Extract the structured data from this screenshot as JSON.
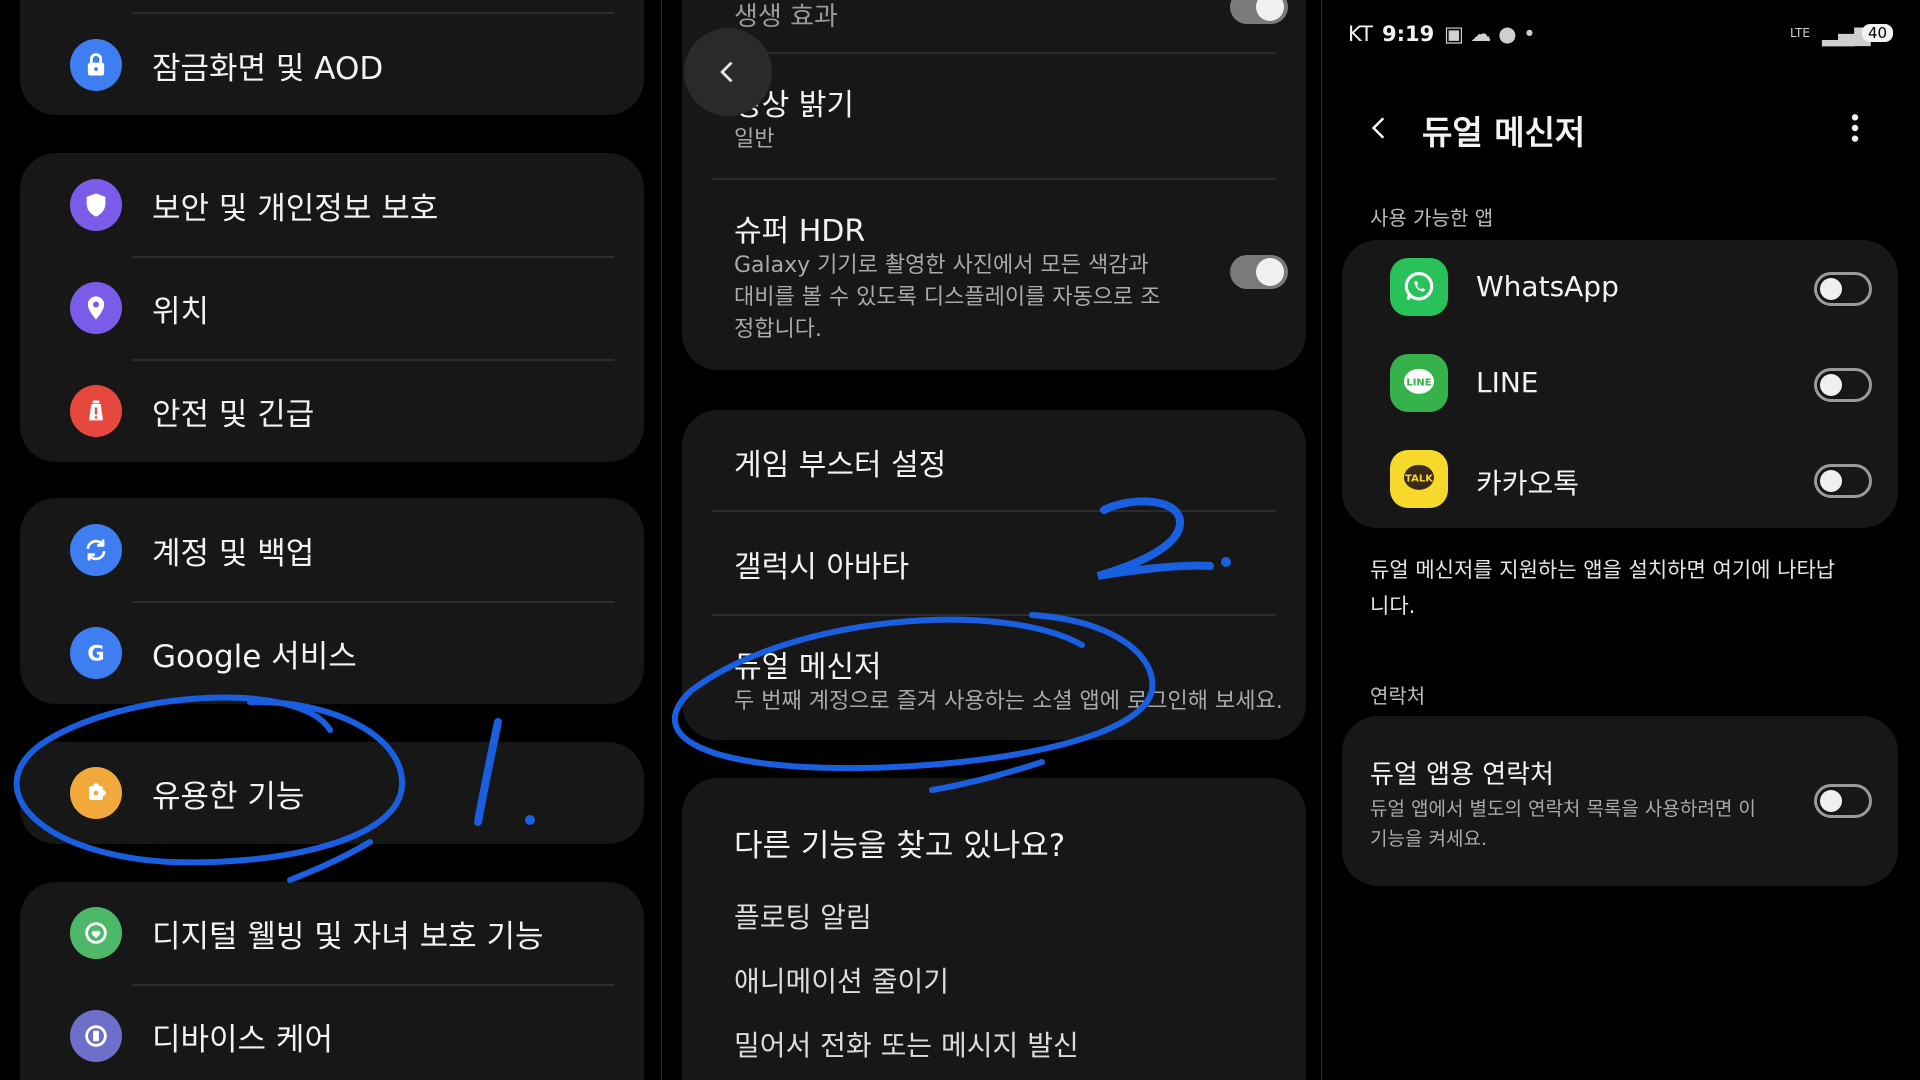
{
  "panel1": {
    "items": [
      {
        "label": "잠금화면 및 AOD",
        "icon": "lock-icon",
        "color": "#3e7ef0"
      },
      {
        "label": "보안 및 개인정보 보호",
        "icon": "shield-icon",
        "color": "#7b5ce8"
      },
      {
        "label": "위치",
        "icon": "location-icon",
        "color": "#7b5ce8"
      },
      {
        "label": "안전 및 긴급",
        "icon": "alert-icon",
        "color": "#e5483c"
      },
      {
        "label": "계정 및 백업",
        "icon": "sync-icon",
        "color": "#3e7ef0"
      },
      {
        "label": "Google 서비스",
        "icon": "google-icon",
        "color": "#3e7ef0"
      },
      {
        "label": "유용한 기능",
        "icon": "puzzle-icon",
        "color": "#f2a93b"
      },
      {
        "label": "디지털 웰빙 및 자녀 보호 기능",
        "icon": "wellbeing-icon",
        "color": "#4cb868"
      },
      {
        "label": "디바이스 케어",
        "icon": "device-care-icon",
        "color": "#6d6fc8"
      }
    ],
    "annotation": "1."
  },
  "panel2": {
    "top_partial": "생생 효과",
    "video_brightness": {
      "title": "영상 밝기",
      "value": "일반"
    },
    "super_hdr": {
      "title": "슈퍼 HDR",
      "desc": "Galaxy 기기로 촬영한 사진에서 모든 색감과 대비를 볼 수 있도록 디스플레이를 자동으로 조정합니다.",
      "on": true
    },
    "game_booster": "게임 부스터 설정",
    "galaxy_avatar": "갤럭시 아바타",
    "dual_messenger": {
      "title": "듀얼 메신저",
      "desc": "두 번째 계정으로 즐겨 사용하는 소셜 앱에 로그인해 보세요."
    },
    "looking_for": {
      "title": "다른 기능을 찾고 있나요?",
      "links": [
        "플로팅 알림",
        "애니메이션 줄이기",
        "밀어서 전화 또는 메시지 발신"
      ]
    },
    "annotation": "2."
  },
  "panel3": {
    "status": {
      "carrier": "KT",
      "time": "9:19",
      "battery": "40",
      "net": "LTE"
    },
    "title": "듀얼 메신저",
    "available_header": "사용 가능한 앱",
    "apps": [
      {
        "name": "WhatsApp",
        "icon": "whatsapp-icon",
        "color": "#29c25a",
        "on": false
      },
      {
        "name": "LINE",
        "icon": "line-icon",
        "color": "#36b24a",
        "on": false
      },
      {
        "name": "카카오톡",
        "icon": "kakaotalk-icon",
        "color": "#f7d92b",
        "on": false
      }
    ],
    "info": "듀얼 메신저를 지원하는 앱을 설치하면 여기에 나타납니다.",
    "contacts_header": "연락처",
    "dual_contacts": {
      "title": "듀얼 앱용 연락처",
      "desc": "듀얼 앱에서 별도의 연락처 목록을 사용하려면 이 기능을 켜세요.",
      "on": false
    }
  }
}
